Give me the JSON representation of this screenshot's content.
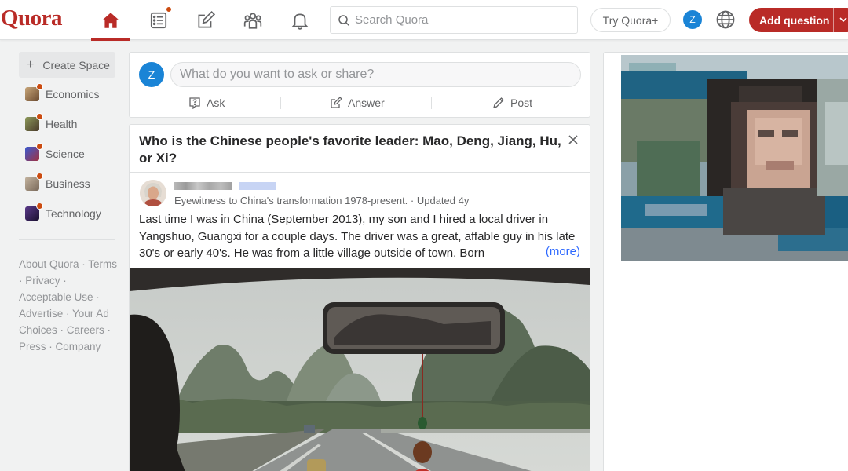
{
  "brand": {
    "logo_text": "Quora",
    "accent": "#b92b27"
  },
  "topnav": {
    "items": [
      {
        "name": "home",
        "icon": "home-icon",
        "active": true
      },
      {
        "name": "following",
        "icon": "following-list-icon",
        "active": false,
        "has_notification": true
      },
      {
        "name": "answer",
        "icon": "answer-pencil-icon",
        "active": false
      },
      {
        "name": "spaces",
        "icon": "spaces-people-icon",
        "active": false
      },
      {
        "name": "notifications",
        "icon": "bell-icon",
        "active": false
      }
    ],
    "search_placeholder": "Search Quora",
    "try_plus_label": "Try Quora+",
    "user_initial": "Z",
    "add_question_label": "Add question"
  },
  "sidebar": {
    "create_space_label": "Create Space",
    "topics": [
      {
        "label": "Economics",
        "color": "#8a6b4f"
      },
      {
        "label": "Health",
        "color": "#6f7b4a"
      },
      {
        "label": "Science",
        "color": "#2a3c8a"
      },
      {
        "label": "Business",
        "color": "#9b8a7a"
      },
      {
        "label": "Technology",
        "color": "#3a2a5a"
      }
    ],
    "footer_links": "About Quora · Terms · Privacy · Acceptable Use · Advertise · Your Ad Choices · Careers · Press · Company"
  },
  "composer": {
    "user_initial": "Z",
    "placeholder": "What do you want to ask or share?",
    "ask_label": "Ask",
    "answer_label": "Answer",
    "post_label": "Post"
  },
  "feed": {
    "question_title": "Who is the Chinese people's favorite leader: Mao, Deng, Jiang, Hu, or Xi?",
    "credential": "Eyewitness to China's transformation 1978-present. · Updated 4y",
    "answer_excerpt": "Last time I was in China (September 2013), my son and I hired a local driver in Yangshuo, Guangxi for a couple days. The driver was a great, affable guy in his late 30's or early 40's. He was from a little village outside of town. Born",
    "more_label": "(more)"
  }
}
